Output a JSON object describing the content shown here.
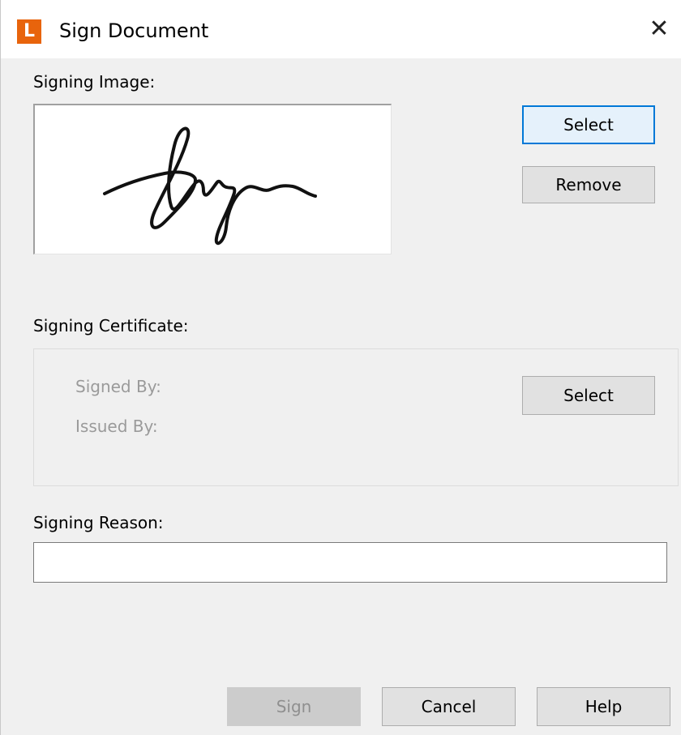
{
  "window": {
    "app_icon_letter": "L",
    "title": "Sign Document",
    "close_glyph": "✕",
    "icon": "close-icon"
  },
  "signing_image": {
    "label": "Signing Image:",
    "select_label": "Select",
    "remove_label": "Remove"
  },
  "signing_certificate": {
    "label": "Signing Certificate:",
    "signed_by_label": "Signed By:",
    "issued_by_label": "Issued By:",
    "select_label": "Select"
  },
  "signing_reason": {
    "label": "Signing Reason:",
    "value": ""
  },
  "footer": {
    "sign_label": "Sign",
    "cancel_label": "Cancel",
    "help_label": "Help"
  },
  "colors": {
    "app_icon": "#e8640c",
    "focus_border": "#0078d7"
  }
}
